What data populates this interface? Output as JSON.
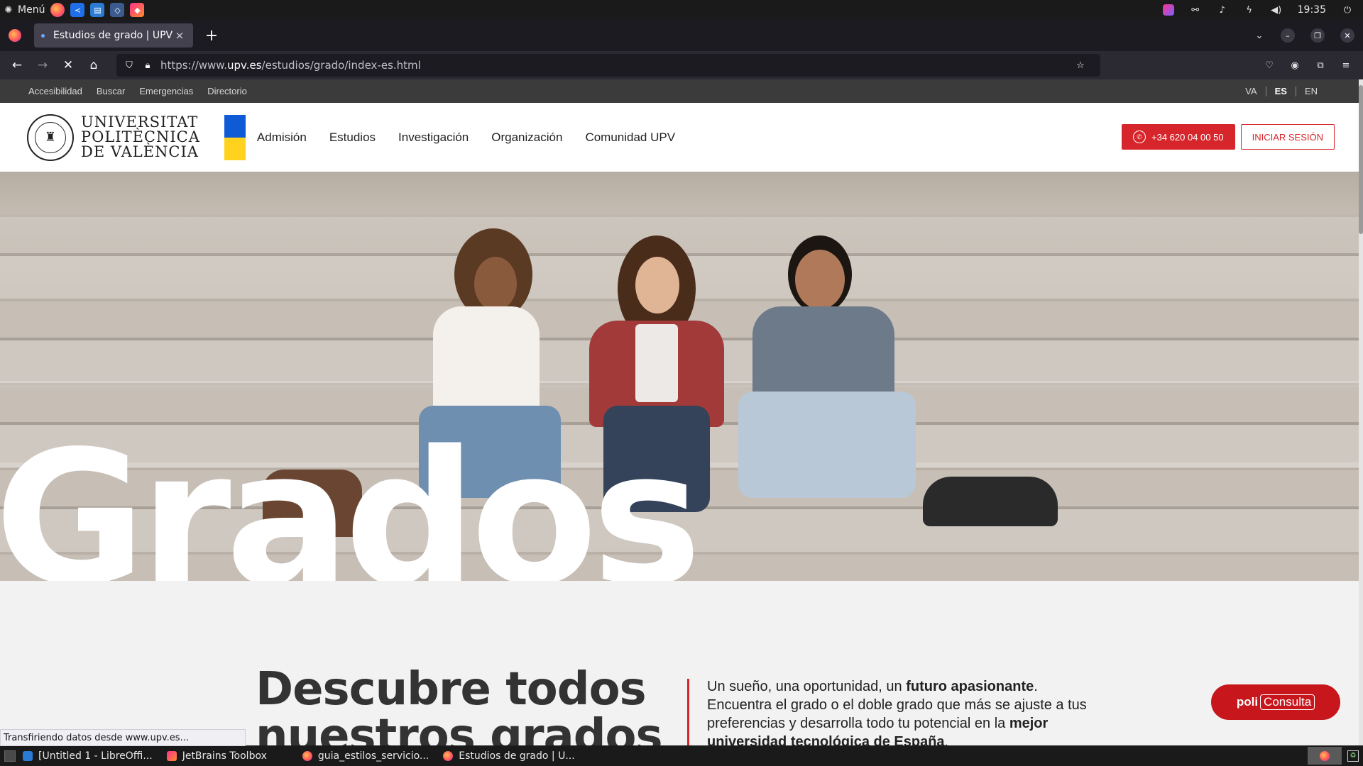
{
  "os_panel": {
    "menu_label": "Menú",
    "clock": "19:35",
    "apps": [
      "firefox-icon",
      "vscode-icon",
      "writer-icon",
      "virtualbox-icon",
      "jetbrains-toolbox-icon"
    ]
  },
  "browser": {
    "tab_title": "Estudios de grado | UPV",
    "tab_close": "×",
    "new_tab": "+",
    "url_prefix": "https://www.",
    "url_host": "upv.es",
    "url_path": "/estudios/grado/index-es.html",
    "status_text": "Transfiriendo datos desde www.upv.es..."
  },
  "site": {
    "utility_links": [
      "Accesibilidad",
      "Buscar",
      "Emergencias",
      "Directorio"
    ],
    "languages": [
      "VA",
      "ES",
      "EN"
    ],
    "active_language": "ES",
    "logo_lines": [
      "UNIVERSITAT",
      "POLITÈCNICA",
      "DE VALÈNCIA"
    ],
    "nav": [
      "Admisión",
      "Estudios",
      "Investigación",
      "Organización",
      "Comunidad UPV"
    ],
    "whatsapp_label": "+34 620 04 00 50",
    "login_label": "INICIAR SESIÓN",
    "hero_title": "Grados",
    "section_title_line1": "Descubre todos",
    "section_title_line2": "nuestros grados",
    "intro": {
      "p1": "Un sueño, una oportunidad, un ",
      "b1": "futuro apasionante",
      "p2": ". Encuentra el grado o el doble grado que más se ajuste a tus preferencias y desarrolla todo tu potencial en la ",
      "b2": "mejor universidad tecnológica de España",
      "p3": "."
    },
    "poli_label": "poli",
    "poli_bracket": "Consulta"
  },
  "colors": {
    "brand_red": "#d7262b",
    "flag_blue": "#0f5bd6",
    "flag_yellow": "#ffd21e"
  },
  "taskbar": {
    "tasks": [
      "[Untitled 1 - LibreOffi...",
      "JetBrains Toolbox",
      "guia_estilos_servicio...",
      "Estudios de grado | U..."
    ]
  }
}
